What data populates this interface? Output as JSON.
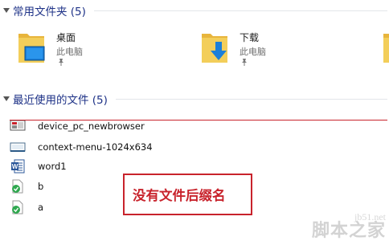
{
  "frequent": {
    "header": "常用文件夹 (5)",
    "items": [
      {
        "name": "桌面",
        "location": "此电脑",
        "icon": "desktop-folder-icon"
      },
      {
        "name": "下载",
        "location": "此电脑",
        "icon": "downloads-folder-icon"
      },
      {
        "name": "",
        "location": "",
        "icon": "folder-icon"
      }
    ]
  },
  "recent": {
    "header": "最近使用的文件 (5)",
    "items": [
      {
        "name": "device_pc_newbrowser",
        "icon": "screenshot-file-icon"
      },
      {
        "name": "context-menu-1024x634",
        "icon": "image-file-icon"
      },
      {
        "name": "word1",
        "icon": "word-document-icon"
      },
      {
        "name": "b",
        "icon": "synced-file-icon"
      },
      {
        "name": "a",
        "icon": "synced-file-icon"
      }
    ]
  },
  "annotation": {
    "text": "没有文件后缀名"
  },
  "watermark": {
    "url": "jb51.net",
    "name": "脚本之家"
  },
  "colors": {
    "accent": "#1e3287",
    "annotation_red": "#c8232c",
    "folder_yellow": "#f3ce5a"
  }
}
